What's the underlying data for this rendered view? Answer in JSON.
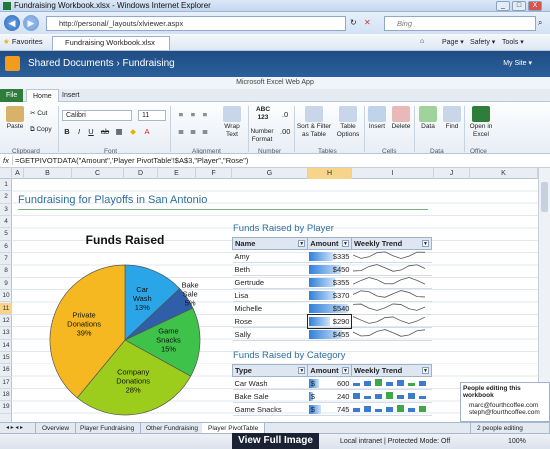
{
  "window": {
    "title": "Fundraising Workbook.xlsx - Windows Internet Explorer",
    "min": "_",
    "max": "□",
    "close": "X"
  },
  "browser": {
    "url": "http://personal/_layouts/xlviewer.aspx",
    "search_placeholder": "Bing",
    "favorites": "Favorites",
    "tab_title": "Fundraising Workbook.xlsx",
    "tools": [
      "Page ▾",
      "Safety ▾",
      "Tools ▾"
    ]
  },
  "sharepoint": {
    "breadcrumb": "Shared Documents › Fundraising",
    "my_site": "My Site ▾"
  },
  "ribbon": {
    "app_name": "Microsoft Excel Web App",
    "tabs": [
      "File",
      "Home",
      "Insert"
    ],
    "font_name": "Calibri",
    "font_size": "11",
    "buttons": {
      "paste": "Paste",
      "cut": "Cut",
      "copy": "Copy",
      "wrap": "Wrap Text",
      "number_format": "Number Format",
      "abc": "ABC 123",
      "sort_filter": "Sort & Filter as Table",
      "table_options": "Table Options",
      "insert": "Insert",
      "delete": "Delete",
      "data": "Data",
      "find": "Find",
      "open_excel": "Open in Excel"
    },
    "groups": [
      "Clipboard",
      "Font",
      "Alignment",
      "Number",
      "Tables",
      "Cells",
      "Data",
      "Office"
    ]
  },
  "formula_bar": {
    "fx": "fx",
    "formula": "=GETPIVOTDATA(\"Amount\",'Player PivotTable'!$A$3,\"Player\",\"Rose\")"
  },
  "columns": [
    "A",
    "B",
    "C",
    "D",
    "E",
    "F",
    "G",
    "H",
    "I",
    "J",
    "K"
  ],
  "rows": [
    "1",
    "2",
    "3",
    "4",
    "5",
    "6",
    "7",
    "8",
    "9",
    "10",
    "11",
    "12",
    "13",
    "14",
    "15",
    "16",
    "17",
    "18",
    "19"
  ],
  "sheet": {
    "title": "Fundraising for Playoffs in San Antonio",
    "chart_data": {
      "type": "pie",
      "title": "Funds Raised",
      "categories": [
        "Car Wash",
        "Bake Sale",
        "Game Snacks",
        "Company Donations",
        "Private Donations"
      ],
      "values": [
        13,
        5,
        15,
        28,
        39
      ],
      "labels": [
        "Car Wash 13%",
        "Bake Sale 5%",
        "Game Snacks 15%",
        "Company Donations 28%",
        "Private Donations 39%"
      ],
      "colors": [
        "#2aa6e8",
        "#2e5fa8",
        "#3fc24a",
        "#9ccd1c",
        "#f5b820"
      ]
    },
    "player_table": {
      "title": "Funds Raised by Player",
      "headers": [
        "Name",
        "Amount",
        "Weekly Trend"
      ],
      "rows": [
        {
          "name": "Amy",
          "amount": "$335",
          "frac": 0.61
        },
        {
          "name": "Beth",
          "amount": "$450",
          "frac": 0.82
        },
        {
          "name": "Gertrude",
          "amount": "$355",
          "frac": 0.65
        },
        {
          "name": "Lisa",
          "amount": "$370",
          "frac": 0.67
        },
        {
          "name": "Michelle",
          "amount": "$540",
          "frac": 0.98
        },
        {
          "name": "Rose",
          "amount": "$290",
          "frac": 0.53
        },
        {
          "name": "Sally",
          "amount": "$455",
          "frac": 0.83
        }
      ]
    },
    "category_table": {
      "title": "Funds Raised by Category",
      "headers": [
        "Type",
        "Amount",
        "Weekly Trend"
      ],
      "rows": [
        {
          "type": "Car Wash",
          "currency": "$",
          "amount": "600",
          "frac": 0.25
        },
        {
          "type": "Bake Sale",
          "currency": "$",
          "amount": "240",
          "frac": 0.1
        },
        {
          "type": "Game Snacks",
          "currency": "$",
          "amount": "745",
          "frac": 0.3
        }
      ]
    }
  },
  "people_editing": {
    "title": "People editing this workbook",
    "users": [
      "marc@fourthcoffee.com",
      "steph@fourthcoffee.com"
    ],
    "count": "2 people editing"
  },
  "sheet_tabs": [
    "Overview",
    "Player Fundraising",
    "Other Fundraising",
    "Player PivotTable"
  ],
  "status": {
    "zone": "Local intranet | Protected Mode: Off",
    "zoom": "100%"
  },
  "overlay": {
    "view_full": "View Full Image"
  }
}
